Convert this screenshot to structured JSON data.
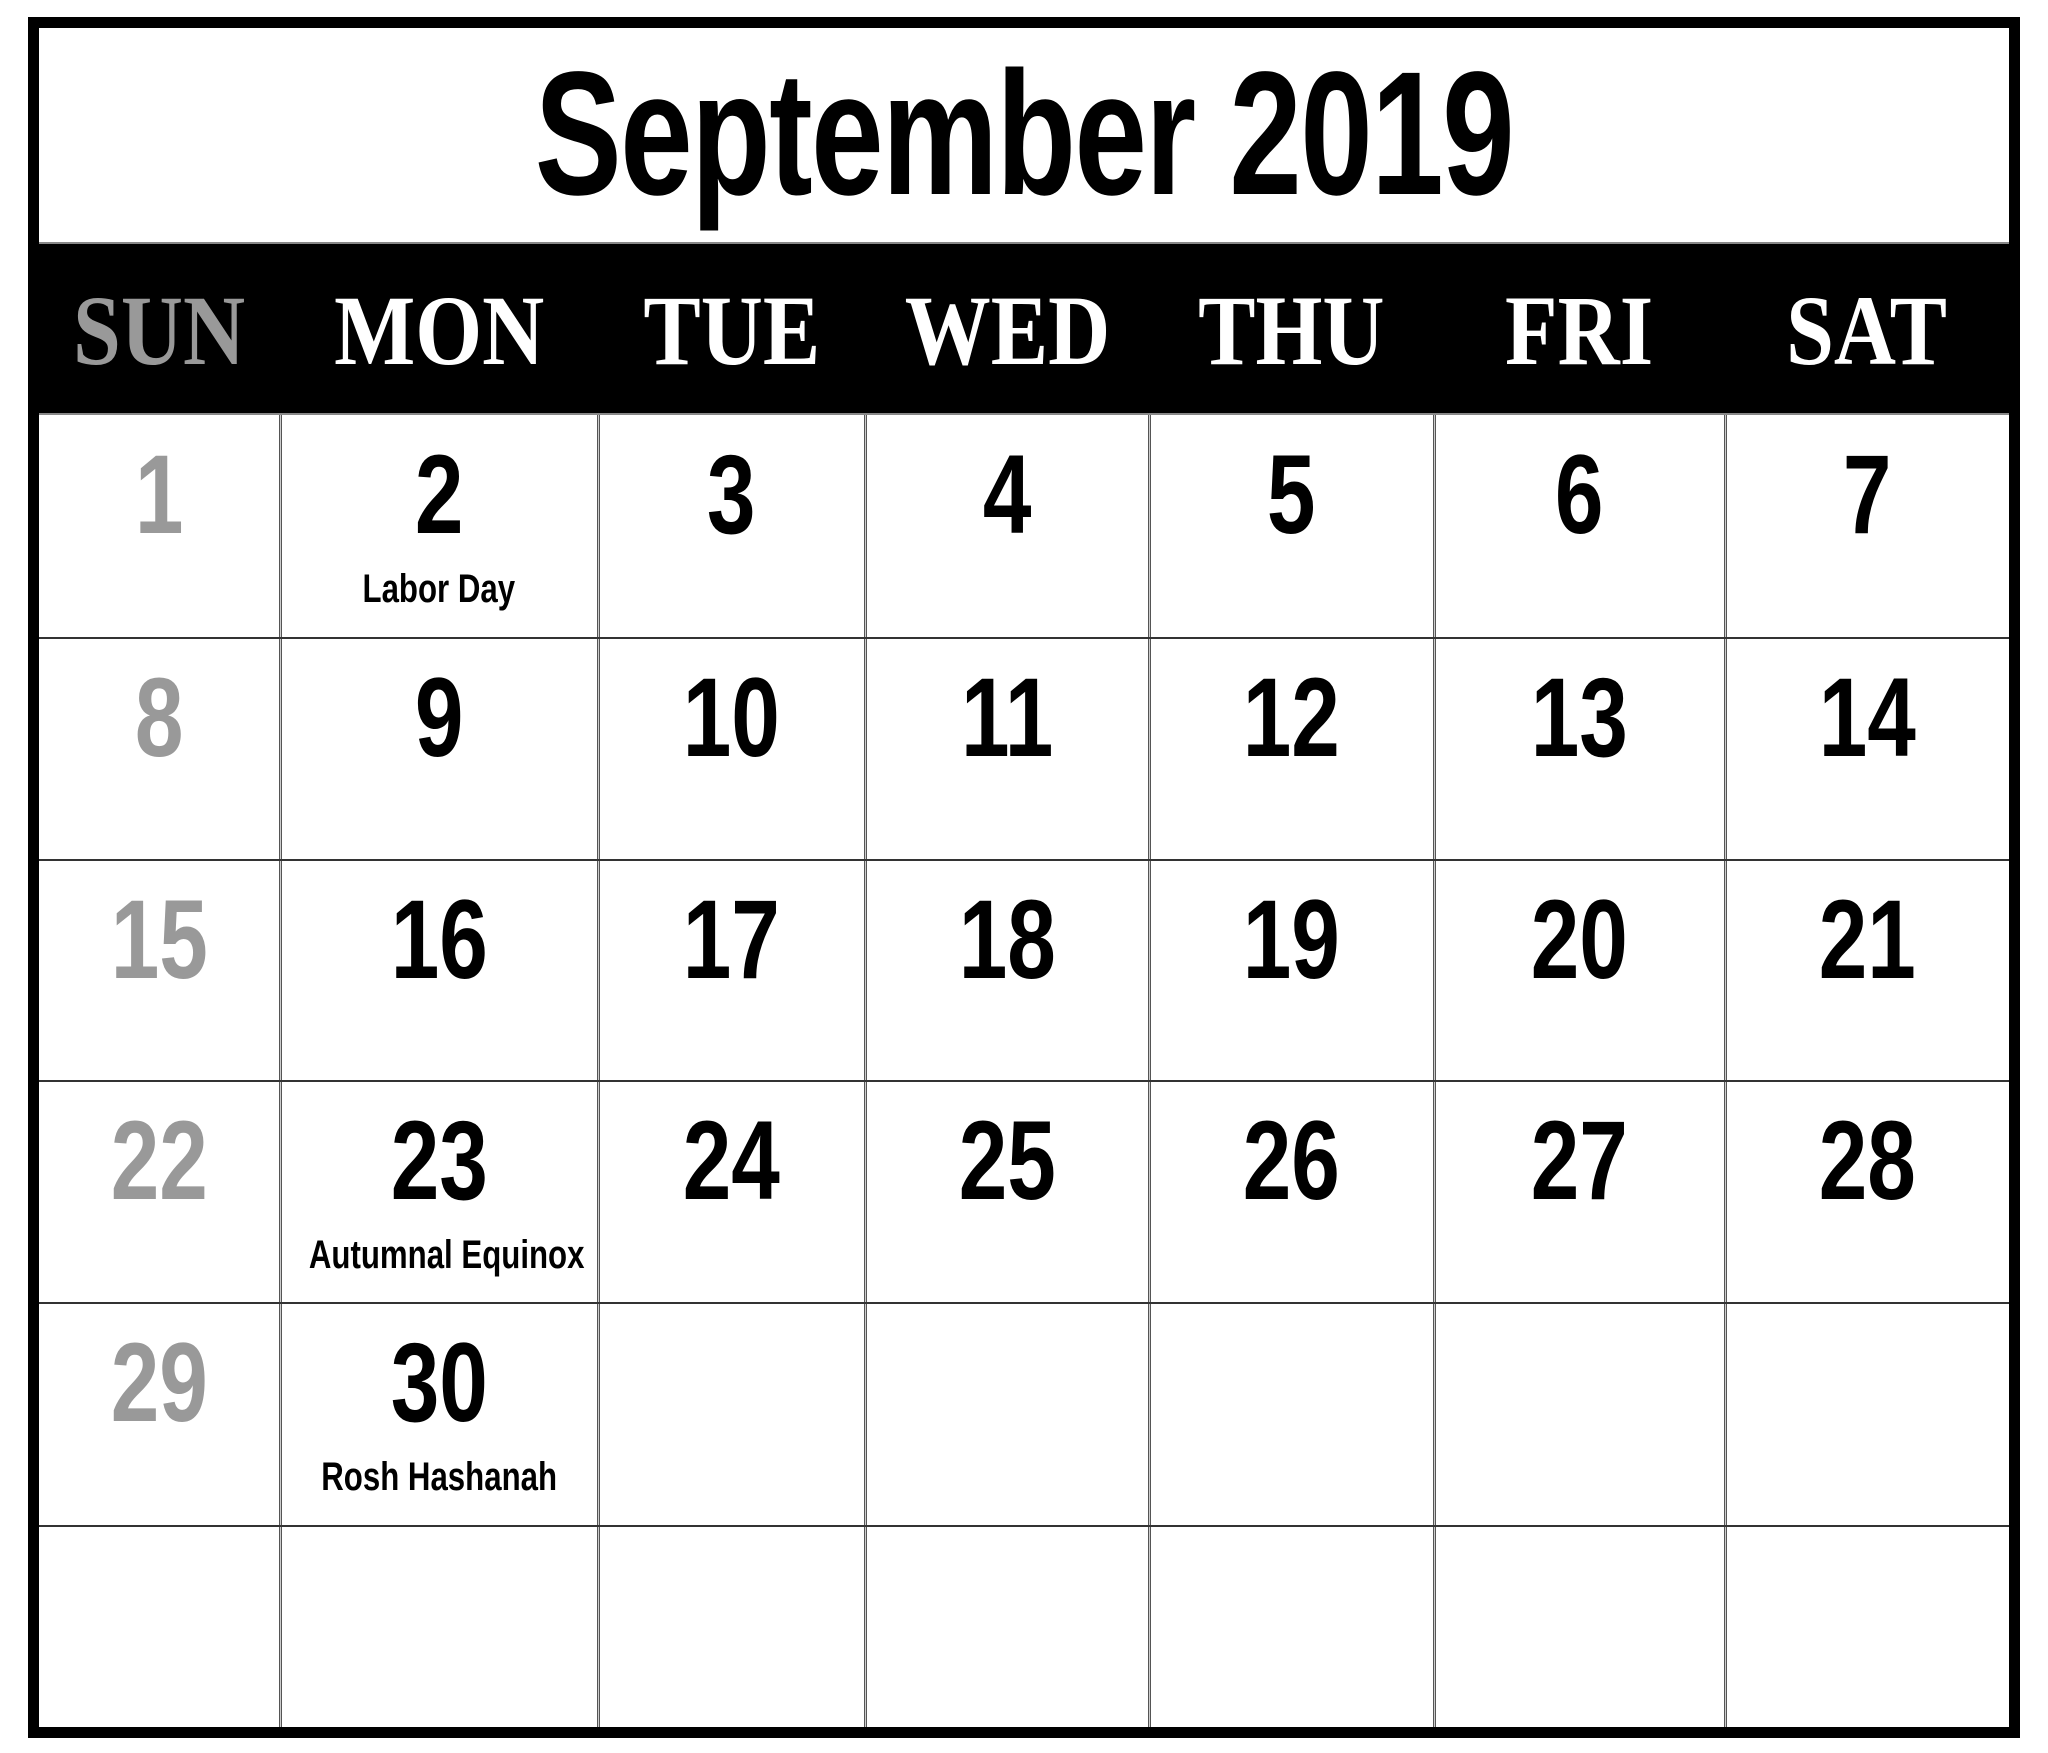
{
  "calendar": {
    "title": "September 2019",
    "weekdays": [
      "SUN",
      "MON",
      "TUE",
      "WED",
      "THU",
      "FRI",
      "SAT"
    ],
    "colors": {
      "weekday_text": "#ffffff",
      "sunday_text": "#999999",
      "day_number": "#000000",
      "header_band": "#000000"
    },
    "weeks": [
      [
        {
          "day": "1"
        },
        {
          "day": "2",
          "event": "Labor Day"
        },
        {
          "day": "3"
        },
        {
          "day": "4"
        },
        {
          "day": "5"
        },
        {
          "day": "6"
        },
        {
          "day": "7"
        }
      ],
      [
        {
          "day": "8"
        },
        {
          "day": "9"
        },
        {
          "day": "10"
        },
        {
          "day": "11"
        },
        {
          "day": "12"
        },
        {
          "day": "13"
        },
        {
          "day": "14"
        }
      ],
      [
        {
          "day": "15"
        },
        {
          "day": "16"
        },
        {
          "day": "17"
        },
        {
          "day": "18"
        },
        {
          "day": "19"
        },
        {
          "day": "20"
        },
        {
          "day": "21"
        }
      ],
      [
        {
          "day": "22"
        },
        {
          "day": "23",
          "event": "Autumnal Equinox"
        },
        {
          "day": "24"
        },
        {
          "day": "25"
        },
        {
          "day": "26"
        },
        {
          "day": "27"
        },
        {
          "day": "28"
        }
      ],
      [
        {
          "day": "29"
        },
        {
          "day": "30",
          "event": "Rosh Hashanah"
        },
        {
          "day": ""
        },
        {
          "day": ""
        },
        {
          "day": ""
        },
        {
          "day": ""
        },
        {
          "day": ""
        }
      ],
      [
        {
          "day": ""
        },
        {
          "day": ""
        },
        {
          "day": ""
        },
        {
          "day": ""
        },
        {
          "day": ""
        },
        {
          "day": ""
        },
        {
          "day": ""
        }
      ]
    ]
  }
}
